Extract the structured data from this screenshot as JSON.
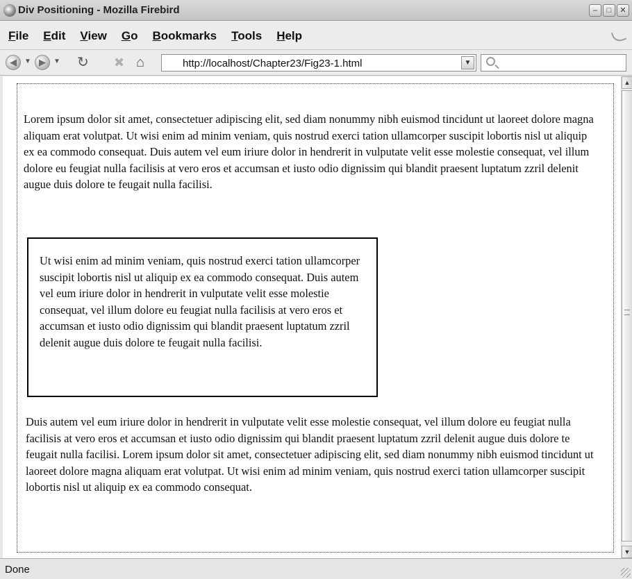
{
  "window": {
    "title": "Div Positioning - Mozilla Firebird",
    "minimize_glyph": "–",
    "maximize_glyph": "□",
    "close_glyph": "✕"
  },
  "menu": {
    "items": [
      {
        "accel": "F",
        "rest": "ile"
      },
      {
        "accel": "E",
        "rest": "dit"
      },
      {
        "accel": "V",
        "rest": "iew"
      },
      {
        "accel": "G",
        "rest": "o"
      },
      {
        "accel": "B",
        "rest": "ookmarks"
      },
      {
        "accel": "T",
        "rest": "ools"
      },
      {
        "accel": "H",
        "rest": "elp"
      }
    ]
  },
  "navbar": {
    "url": "http://localhost/Chapter23/Fig23-1.html",
    "back_glyph": "◀",
    "forward_glyph": "▶",
    "dropdown_glyph": "▼",
    "reload_glyph": "↻",
    "stop_glyph": "✖",
    "home_glyph": "⌂"
  },
  "content": {
    "paragraph1": "Lorem ipsum dolor sit amet, consectetuer adipiscing elit, sed diam nonummy nibh euismod tincidunt ut laoreet dolore magna aliquam erat volutpat. Ut wisi enim ad minim veniam, quis nostrud exerci tation ullamcorper suscipit lobortis nisl ut aliquip ex ea commodo consequat. Duis autem vel eum iriure dolor in hendrerit in vulputate velit esse molestie consequat, vel illum dolore eu feugiat nulla facilisis at vero eros et accumsan et iusto odio dignissim qui blandit praesent luptatum zzril delenit augue duis dolore te feugait nulla facilisi.",
    "boxed_paragraph": "Ut wisi enim ad minim veniam, quis nostrud exerci tation ullamcorper suscipit lobortis nisl ut aliquip ex ea commodo consequat. Duis autem vel eum iriure dolor in hendrerit in vulputate velit esse molestie consequat, vel illum dolore eu feugiat nulla facilisis at vero eros et accumsan et iusto odio dignissim qui blandit praesent luptatum zzril delenit augue duis dolore te feugait nulla facilisi.",
    "paragraph3": "Duis autem vel eum iriure dolor in hendrerit in vulputate velit esse molestie consequat, vel illum dolore eu feugiat nulla facilisis at vero eros et accumsan et iusto odio dignissim qui blandit praesent luptatum zzril delenit augue duis dolore te feugait nulla facilisi. Lorem ipsum dolor sit amet, consectetuer adipiscing elit, sed diam nonummy nibh euismod tincidunt ut laoreet dolore magna aliquam erat volutpat. Ut wisi enim ad minim veniam, quis nostrud exerci tation ullamcorper suscipit lobortis nisl ut aliquip ex ea commodo consequat."
  },
  "scrollbar": {
    "up_glyph": "▲",
    "down_glyph": "▼"
  },
  "status": {
    "text": "Done"
  }
}
